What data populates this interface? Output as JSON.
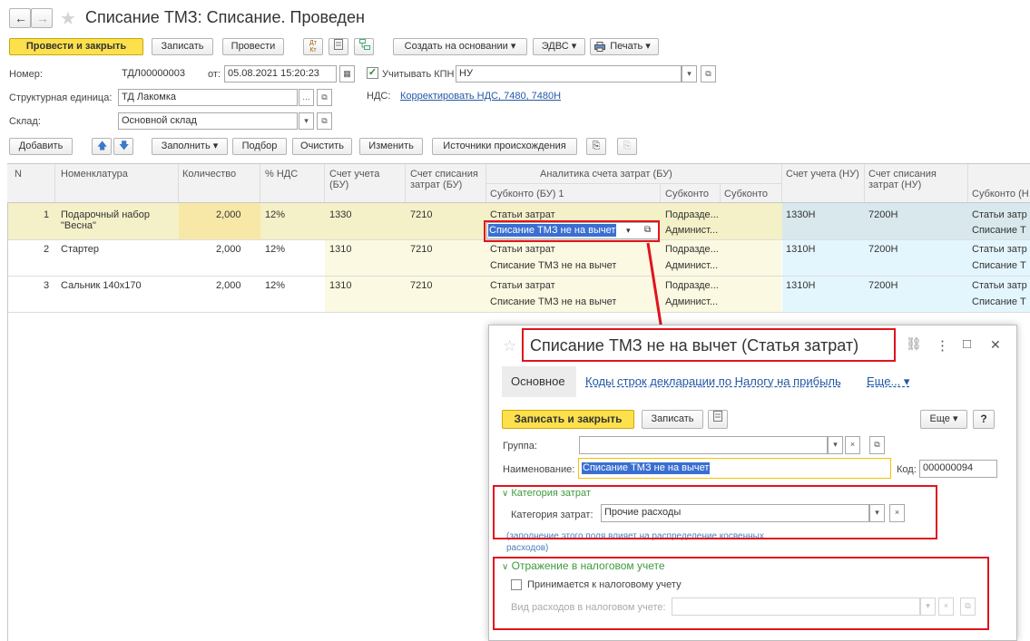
{
  "header": {
    "back": "←",
    "forward": "→",
    "star": "★",
    "title": "Списание ТМЗ: Списание. Проведен"
  },
  "toolbar": {
    "post_close": "Провести и закрыть",
    "save": "Записать",
    "post": "Провести",
    "dtkt": "Дт\nКт",
    "create_based": "Создать на основании ▾",
    "edvs": "ЭДВС ▾",
    "print": "Печать ▾"
  },
  "form": {
    "number_label": "Номер:",
    "number": "ТДЛ00000003",
    "date_label": "от:",
    "date": "05.08.2021 15:20:23",
    "kpn_label": "Учитывать КПН",
    "kpn_value": "НУ",
    "unit_label": "Структурная единица:",
    "unit": "ТД Лакомка",
    "vat_label": "НДС:",
    "vat_link": "Корректировать НДС, 7480, 7480Н",
    "warehouse_label": "Склад:",
    "warehouse": "Основной склад"
  },
  "table_toolbar": {
    "add": "Добавить",
    "fill": "Заполнить ▾",
    "pick": "Подбор",
    "clear": "Очистить",
    "change": "Изменить",
    "sources": "Источники происхождения"
  },
  "table": {
    "headers": {
      "n": "N",
      "item": "Номенклатура",
      "qty": "Количество",
      "vat": "% НДС",
      "acc_bu": "Счет учета (БУ)",
      "acc_write_bu": "Счет списания затрат (БУ)",
      "analytics": "Аналитика счета затрат (БУ)",
      "sub1": "Субконто (БУ) 1",
      "sub2": "Субконто",
      "sub3": "Субконто",
      "acc_nu": "Счет учета (НУ)",
      "acc_write_nu": "Счет списания затрат (НУ)",
      "sub_nu": "Субконто (Н"
    },
    "rows": [
      {
        "n": "1",
        "item": "Подарочный набор",
        "item2": "\"Весна\"",
        "qty": "2,000",
        "vat": "12%",
        "acc": "1330",
        "write": "7210",
        "s1a": "Статьи затрат",
        "s1b": "Списание ТМЗ не на вычет",
        "s2a": "Подразде...",
        "s2b": "Админист...",
        "nu": "1330Н",
        "wnu": "7200Н",
        "snua": "Статьи затр",
        "snub": "Списание Т"
      },
      {
        "n": "2",
        "item": "Стартер",
        "item2": "",
        "qty": "2,000",
        "vat": "12%",
        "acc": "1310",
        "write": "7210",
        "s1a": "Статьи затрат",
        "s1b": "Списание ТМЗ не на вычет",
        "s2a": "Подразде...",
        "s2b": "Админист...",
        "nu": "1310Н",
        "wnu": "7200Н",
        "snua": "Статьи затр",
        "snub": "Списание Т"
      },
      {
        "n": "3",
        "item": "Сальник 140х170",
        "item2": "",
        "qty": "2,000",
        "vat": "12%",
        "acc": "1310",
        "write": "7210",
        "s1a": "Статьи затрат",
        "s1b": "Списание ТМЗ не на вычет",
        "s2a": "Подразде...",
        "s2b": "Админист...",
        "nu": "1310Н",
        "wnu": "7200Н",
        "snua": "Статьи затр",
        "snub": "Списание Т"
      }
    ]
  },
  "dialog": {
    "star": "☆",
    "title": "Списание ТМЗ не на вычет (Статья затрат)",
    "link_icon": "🔗",
    "menu": "⋮",
    "max": "□",
    "close": "✕",
    "tab_main": "Основное",
    "tab_codes": "Коды строк декларации по Налогу на прибыль",
    "tab_more": "Еще... ▾",
    "save_close": "Записать и закрыть",
    "save": "Записать",
    "more": "Еще ▾",
    "help": "?",
    "group_label": "Группа:",
    "group_value": "",
    "name_label": "Наименование:",
    "name_value": "Списание ТМЗ не на вычет",
    "code_label": "Код:",
    "code_value": "000000094",
    "section_cat": "Категория затрат",
    "cat_label": "Категория затрат:",
    "cat_value": "Прочие расходы",
    "cat_note1": "(заполнение этого поля влияет на распределение косвенных",
    "cat_note2": "расходов)",
    "section_tax": "Отражение в налоговом учете",
    "tax_check": "Принимается к налоговому учету",
    "tax_kind_label": "Вид расходов в налоговом учете:"
  },
  "colors": {
    "accent_yellow": "#fce04c",
    "red_box": "#e0141e",
    "link": "#2459a6",
    "green_section": "#3c9a3c"
  }
}
